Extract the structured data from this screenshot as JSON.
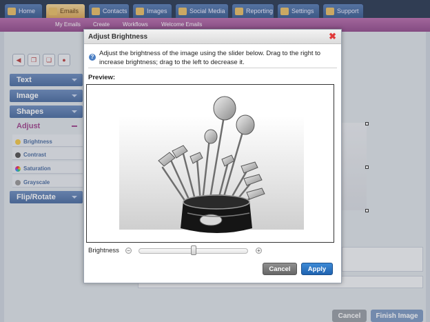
{
  "nav": {
    "tabs": [
      {
        "label": "Home",
        "icon": "home-icon"
      },
      {
        "label": "Emails",
        "icon": "envelope-icon"
      },
      {
        "label": "Contacts",
        "icon": "contacts-icon"
      },
      {
        "label": "Images",
        "icon": "images-icon"
      },
      {
        "label": "Social Media",
        "icon": "social-icon"
      },
      {
        "label": "Reporting",
        "icon": "chart-icon"
      },
      {
        "label": "Settings",
        "icon": "gear-icon"
      },
      {
        "label": "Support",
        "icon": "support-icon"
      }
    ],
    "subtabs": [
      "My Emails",
      "Create",
      "Workflows",
      "Welcome Emails"
    ]
  },
  "sidebar": {
    "sections": [
      "Text",
      "Image",
      "Shapes"
    ],
    "adjust": "Adjust",
    "adjust_items": [
      "Brightness",
      "Contrast",
      "Saturation",
      "Grayscale"
    ],
    "flip": "Flip/Rotate"
  },
  "footer": {
    "cancel": "Cancel",
    "finish": "Finish Image"
  },
  "dialog": {
    "title": "Adjust Brightness",
    "description": "Adjust the brightness of the image using the slider below. Drag to the right to increase brightness; drag to the left to decrease it.",
    "preview_label": "Preview:",
    "brightness_label": "Brightness",
    "brightness_level": 0.5,
    "cancel": "Cancel",
    "apply": "Apply"
  },
  "colors": {
    "apply": "#1f63b0",
    "subnav": "#944f8f",
    "close": "#e03a3a"
  }
}
